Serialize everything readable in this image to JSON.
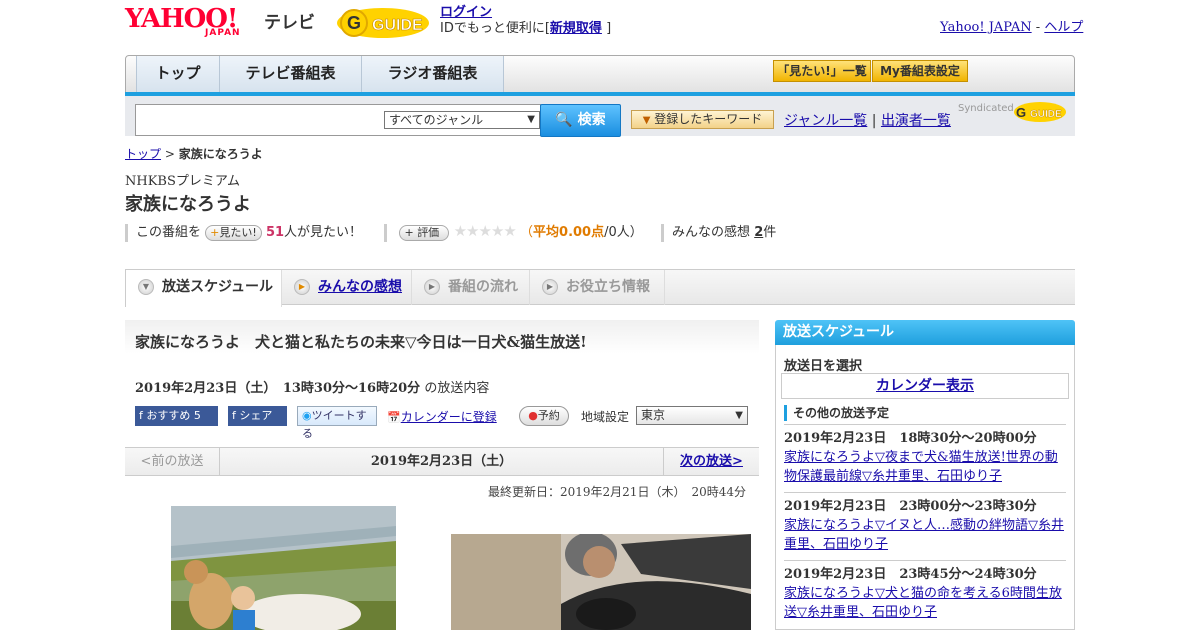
{
  "header": {
    "logo": "YAHOO!",
    "logo_sub": "JAPAN",
    "service": "テレビ",
    "gguide": "G-GUIDE",
    "login": "ログイン",
    "login_note_prefix": "IDでもっと便利に[",
    "signup": "新規取得",
    "login_note_suffix": "]",
    "yahoo_japan": "Yahoo! JAPAN",
    "dash": "-",
    "help": "ヘルプ"
  },
  "nav": {
    "tabs": [
      "トップ",
      "テレビ番組表",
      "ラジオ番組表"
    ],
    "want_list": "「見たい!」一覧",
    "my_program": "My番組表設定"
  },
  "search": {
    "value": "",
    "genre_selected": "すべてのジャンル",
    "button": "検索",
    "keyword_button": "登録したキーワード",
    "genre_list": "ジャンル一覧",
    "separator": "|",
    "cast_list": "出演者一覧",
    "syndicated": "Syndicated",
    "gguide_small": "G-GUIDE"
  },
  "breadcrumb": {
    "top": "トップ",
    "sep": ">",
    "current": "家族になろうよ"
  },
  "program": {
    "channel": "NHKBSプレミアム",
    "title": "家族になろうよ",
    "this_program": "この番組を",
    "want_btn": "見たい!",
    "want_count": "51",
    "want_suffix": "人が見たい！",
    "rate_btn": "評価",
    "stars": "★★★★★",
    "avg_open": "（",
    "avg_label": "平均",
    "avg_value": "0.00点",
    "avg_people": "/0人）",
    "impressions_label": "みんなの感想",
    "impressions_count": "2",
    "impressions_suffix": "件"
  },
  "tabs": [
    {
      "label": "放送スケジュール",
      "icon": "▼"
    },
    {
      "label": "みんなの感想",
      "icon": "▶"
    },
    {
      "label": "番組の流れ",
      "icon": "▶"
    },
    {
      "label": "お役立ち情報",
      "icon": "▶"
    }
  ],
  "broadcast": {
    "title": "家族になろうよ　犬と猫と私たちの未来▽今日は一日犬&猫生放送!",
    "date": "2019年2月23日（土）　13時30分～16時20分",
    "date_suffix": "の放送内容",
    "recommend": "おすすめ",
    "recommend_count": "5",
    "share": "シェア",
    "tweet": "ツイートする",
    "calendar_register": "カレンダーに登録",
    "reserve": "予約",
    "region_label": "地域設定",
    "region_value": "東京",
    "prev": "<前の放送",
    "current_date": "2019年2月23日（土）",
    "next": "次の放送>",
    "updated": "最終更新日：2019年2月21日（木）　20時44分"
  },
  "schedule": {
    "header": "放送スケジュール",
    "select_day": "放送日を選択",
    "calendar_btn": "カレンダー表示",
    "other_label": "その他の放送予定",
    "items": [
      {
        "date": "2019年2月23日　18時30分～20時00分",
        "title": "家族になろうよ▽夜まで犬&猫生放送!世界の動物保護最前線▽糸井重里、石田ゆり子"
      },
      {
        "date": "2019年2月23日　23時00分～23時30分",
        "title": "家族になろうよ▽イヌと人…感動の絆物語▽糸井重里、石田ゆり子"
      },
      {
        "date": "2019年2月23日　23時45分～24時30分",
        "title": "家族になろうよ▽犬と猫の命を考える6時間生放送▽糸井重里、石田ゆり子"
      }
    ]
  },
  "colors": {
    "accent": "#1ea0e0",
    "brand": "#ff0033",
    "link": "#1a0dab",
    "want_count": "#cc3366",
    "avg": "#e07b00"
  }
}
